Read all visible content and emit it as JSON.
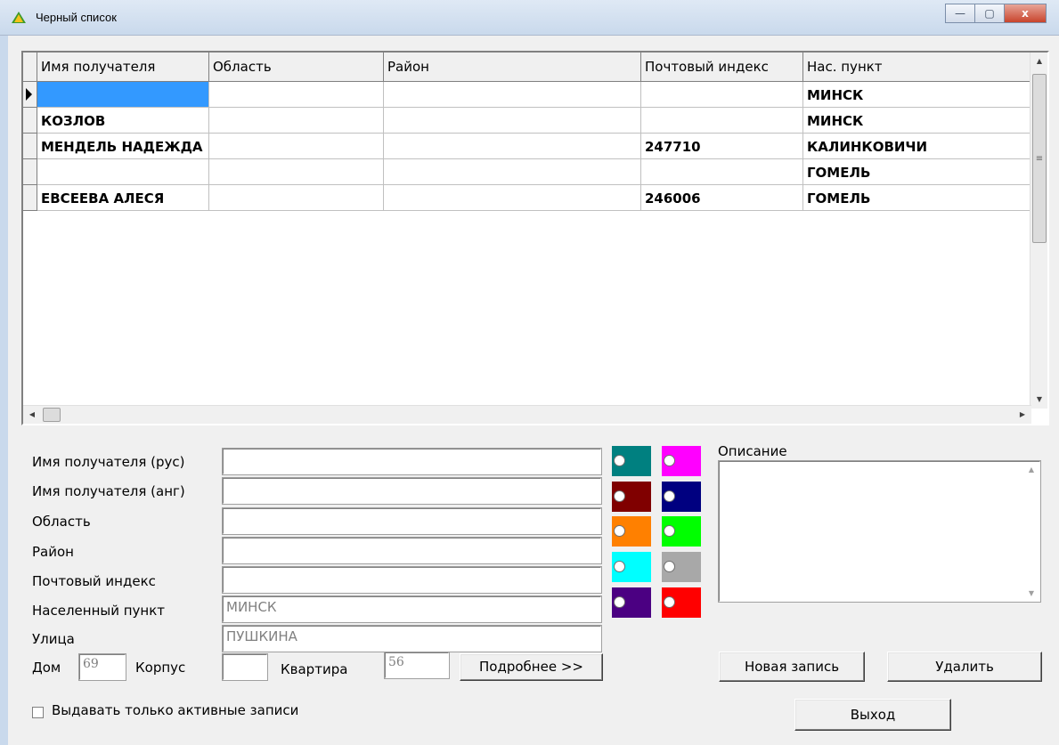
{
  "window": {
    "title": "Черный список",
    "minimize_glyph": "—",
    "maximize_glyph": "▢",
    "close_glyph": "x"
  },
  "grid": {
    "columns": [
      "Имя получателя",
      "Область",
      "Район",
      "Почтовый индекс",
      "Нас. пункт"
    ],
    "rows": [
      [
        "",
        "",
        "",
        "",
        "МИНСК"
      ],
      [
        "КОЗЛОВ",
        "",
        "",
        "",
        "МИНСК"
      ],
      [
        "МЕНДЕЛЬ НАДЕЖДА",
        "",
        "",
        "247710",
        "КАЛИНКОВИЧИ"
      ],
      [
        "",
        "",
        "",
        "",
        "ГОМЕЛЬ"
      ],
      [
        "ЕВСЕЕВА АЛЕСЯ",
        "",
        "",
        "246006",
        "ГОМЕЛЬ"
      ]
    ],
    "selected_row": 0
  },
  "form": {
    "name_rus_label": "Имя получателя (рус)",
    "name_rus_value": "",
    "name_eng_label": "Имя получателя (анг)",
    "name_eng_value": "",
    "region_label": "Область",
    "region_value": "",
    "district_label": "Район",
    "district_value": "",
    "postcode_label": "Почтовый индекс",
    "postcode_value": "",
    "locality_label": "Населенный пункт",
    "locality_value": "МИНСК",
    "street_label": "Улица",
    "street_value": "ПУШКИНА",
    "house_label": "Дом",
    "house_value": "69",
    "block_label": "Корпус",
    "block_value": "",
    "flat_label": "Квартира",
    "flat_value": "56",
    "more_button": "Подробнее >>"
  },
  "colors": [
    "#008080",
    "#ff00ff",
    "#800000",
    "#000080",
    "#ff8000",
    "#00ff00",
    "#00ffff",
    "#a8a8a8",
    "#4b0082",
    "#ff0000"
  ],
  "description": {
    "label": "Описание",
    "value": ""
  },
  "buttons": {
    "new_record": "Новая запись",
    "delete": "Удалить",
    "exit": "Выход"
  },
  "active_only": {
    "label": "Выдавать только активные записи",
    "checked": false
  }
}
